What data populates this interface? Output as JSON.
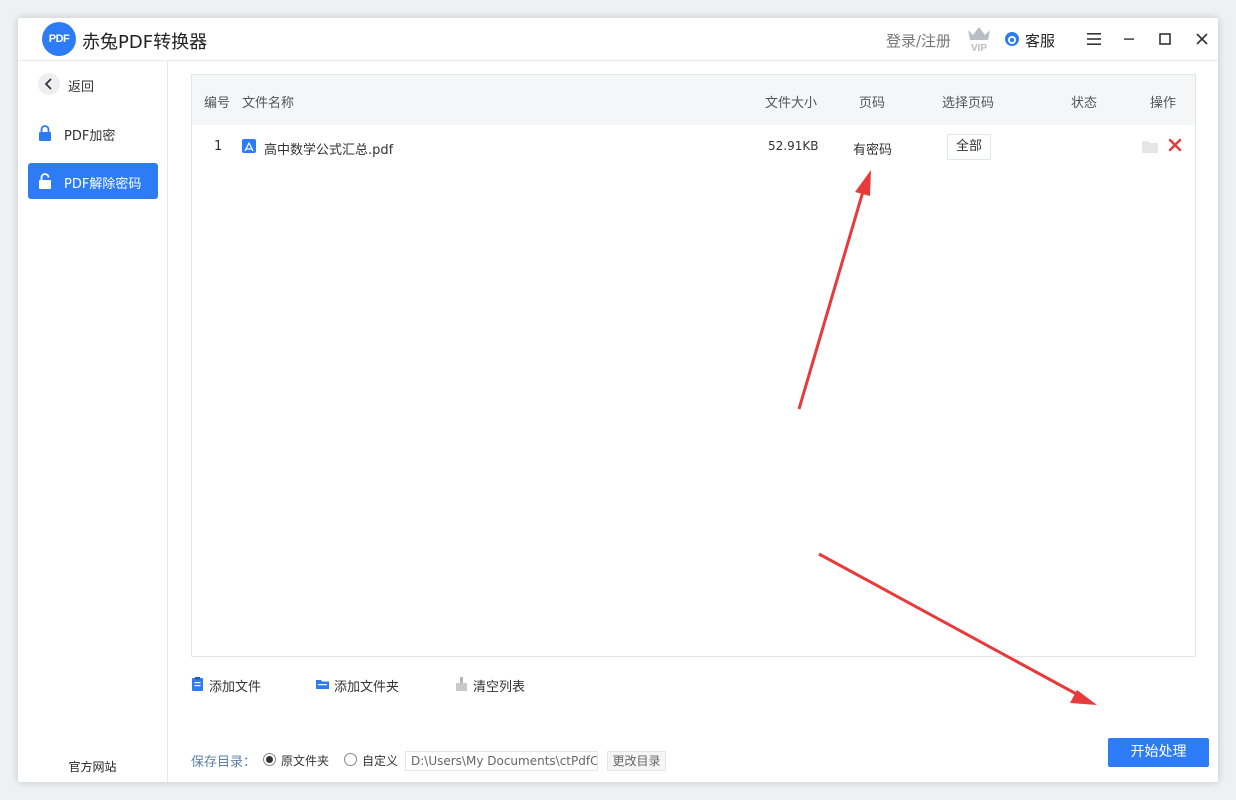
{
  "app": {
    "title": "赤兔PDF转换器",
    "logo_text": "PDF",
    "login": "登录/注册",
    "vip_text": "VIP",
    "customer_service": "客服"
  },
  "sidebar": {
    "back_label": "返回",
    "items": [
      {
        "label": "PDF加密",
        "active": false
      },
      {
        "label": "PDF解除密码",
        "active": true
      }
    ],
    "website_label": "官方网站"
  },
  "table": {
    "headers": {
      "index": "编号",
      "name": "文件名称",
      "size": "文件大小",
      "pages": "页码",
      "select_pages": "选择页码",
      "status": "状态",
      "actions": "操作"
    },
    "rows": [
      {
        "index": "1",
        "name": "高中数学公式汇总.pdf",
        "size": "52.91KB",
        "pages": "有密码",
        "select_pages": "全部",
        "status": ""
      }
    ]
  },
  "toolbar": {
    "add_file": "添加文件",
    "add_folder": "添加文件夹",
    "clear_list": "清空列表"
  },
  "bottom": {
    "save_dir_label": "保存目录：",
    "option_original": "原文件夹",
    "option_custom": "自定义",
    "path_value": "D:\\Users\\My Documents\\ctPdfCon",
    "change_dir": "更改目录",
    "start": "开始处理"
  },
  "colors": {
    "accent": "#2d7cf6",
    "annotation_arrow": "#e83a3a",
    "delete": "#e83a3a"
  }
}
